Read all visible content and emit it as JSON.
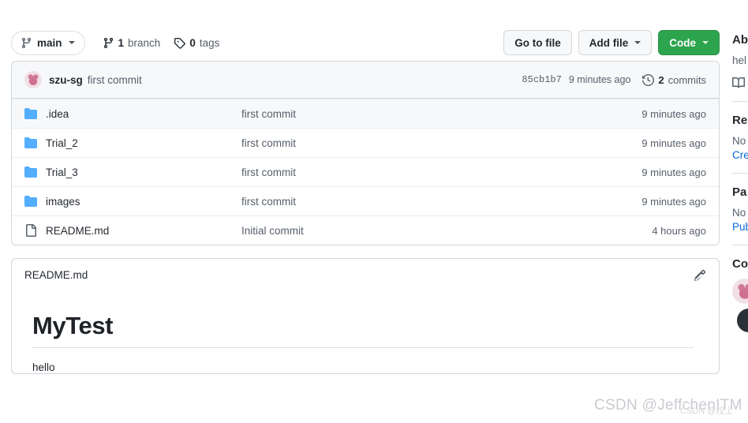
{
  "toolbar": {
    "branch_label": "main",
    "branch_icon": "branch-icon",
    "branches_count": "1",
    "branches_label": "branch",
    "branches_icon": "branch-icon",
    "tags_count": "0",
    "tags_label": "tags",
    "tags_icon": "tag-icon",
    "go_to_file_label": "Go to file",
    "add_file_label": "Add file",
    "code_label": "Code",
    "code_color": "#2da44e"
  },
  "commit_bar": {
    "avatar_name": "user-avatar",
    "author": "szu-sg",
    "message": "first commit",
    "sha": "85cb1b7",
    "time": "9 minutes ago",
    "history_icon": "history-icon",
    "commits_count": "2",
    "commits_label": "commits"
  },
  "files": [
    {
      "type": "folder",
      "icon": "folder-icon",
      "name": ".idea",
      "message": "first commit",
      "time": "9 minutes ago"
    },
    {
      "type": "folder",
      "icon": "folder-icon",
      "name": "Trial_2",
      "message": "first commit",
      "time": "9 minutes ago"
    },
    {
      "type": "folder",
      "icon": "folder-icon",
      "name": "Trial_3",
      "message": "first commit",
      "time": "9 minutes ago"
    },
    {
      "type": "folder",
      "icon": "folder-icon",
      "name": "images",
      "message": "first commit",
      "time": "9 minutes ago"
    },
    {
      "type": "file",
      "icon": "file-icon",
      "name": "README.md",
      "message": "Initial commit",
      "time": "4 hours ago"
    }
  ],
  "readme": {
    "title": "README.md",
    "edit_icon": "pencil-icon",
    "heading": "MyTest",
    "paragraph": "hello"
  },
  "sidebar": {
    "about_heading": "Ab",
    "about_text": "hel",
    "readme_icon": "book-icon",
    "releases_heading": "Re",
    "releases_none": "No",
    "releases_link": "Cre",
    "packages_heading": "Pa",
    "packages_none": "No",
    "packages_link": "Pub",
    "contributors_heading": "Co"
  },
  "watermark": {
    "text": "CSDN @JeffchenITM",
    "text2": "CSDN @校丄"
  }
}
